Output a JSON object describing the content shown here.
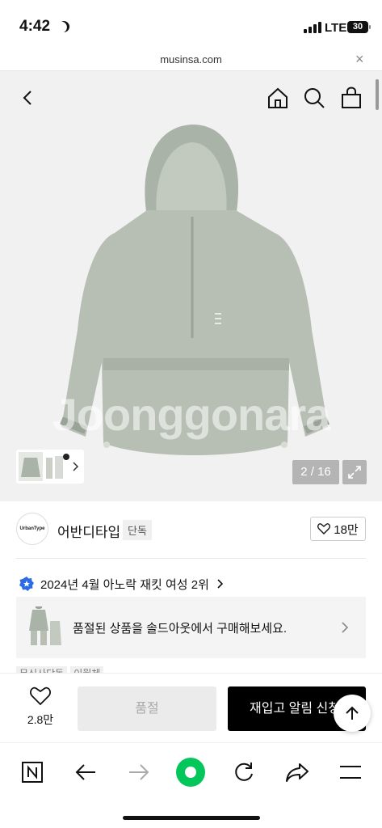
{
  "status_bar": {
    "time": "4:42",
    "network": "LTE",
    "battery": "30"
  },
  "browser": {
    "url": "musinsa.com"
  },
  "gallery": {
    "watermark": "Joonggonara",
    "counter": "2 / 16"
  },
  "brand": {
    "logo_text": "UrbanType",
    "name": "어반디타입",
    "badge": "단독",
    "likes": "18만"
  },
  "ranking": {
    "text": "2024년 4월 아노락 재킷 여성 2위"
  },
  "soldout_banner": {
    "text": "품절된 상품을 솔드아웃에서 구매해보세요."
  },
  "tags": [
    "무신사단독",
    "이월체"
  ],
  "action_bar": {
    "wish_count": "2.8만",
    "soldout_label": "품절",
    "restock_label": "재입고 알림 신청"
  },
  "colors": {
    "product": "#b7bfb4",
    "accent_green": "#03c75a",
    "rank_badge": "#2b6be6"
  },
  "icons": [
    "back-icon",
    "home-icon",
    "search-icon",
    "cart-icon",
    "expand-icon",
    "heart-icon",
    "chevron-right-icon",
    "arrow-up-icon",
    "naver-n-icon",
    "forward-icon",
    "refresh-icon",
    "share-icon",
    "menu-icon"
  ]
}
